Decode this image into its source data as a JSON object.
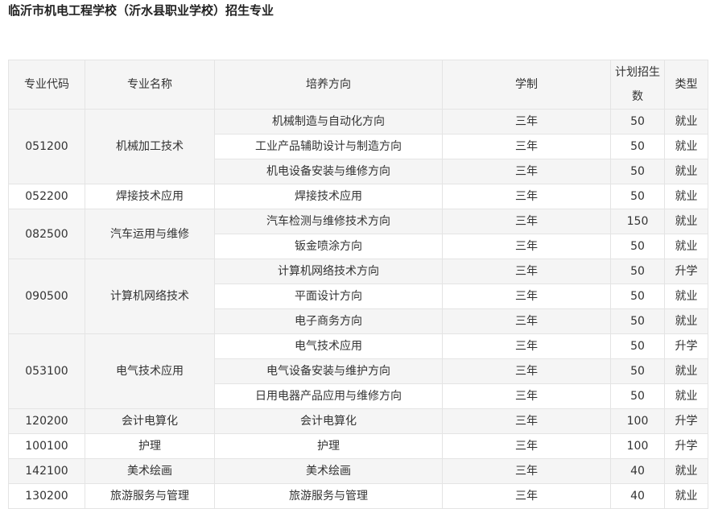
{
  "title": "临沂市机电工程学校（沂水县职业学校）招生专业",
  "headers": {
    "code": "专业代码",
    "name": "专业名称",
    "direction": "培养方向",
    "duration": "学制",
    "plan": "计划招生数",
    "type": "类型"
  },
  "groups": [
    {
      "code": "051200",
      "name": "机械加工技术",
      "rows": [
        {
          "direction": "机械制造与自动化方向",
          "duration": "三年",
          "plan": "50",
          "type": "就业"
        },
        {
          "direction": "工业产品辅助设计与制造方向",
          "duration": "三年",
          "plan": "50",
          "type": "就业"
        },
        {
          "direction": "机电设备安装与维修方向",
          "duration": "三年",
          "plan": "50",
          "type": "就业"
        }
      ]
    },
    {
      "code": "052200",
      "name": "焊接技术应用",
      "rows": [
        {
          "direction": "焊接技术应用",
          "duration": "三年",
          "plan": "50",
          "type": "就业"
        }
      ]
    },
    {
      "code": "082500",
      "name": "汽车运用与维修",
      "rows": [
        {
          "direction": "汽车检测与维修技术方向",
          "duration": "三年",
          "plan": "150",
          "type": "就业"
        },
        {
          "direction": "钣金喷涂方向",
          "duration": "三年",
          "plan": "50",
          "type": "就业"
        }
      ]
    },
    {
      "code": "090500",
      "name": "计算机网络技术",
      "rows": [
        {
          "direction": "计算机网络技术方向",
          "duration": "三年",
          "plan": "50",
          "type": "升学"
        },
        {
          "direction": "平面设计方向",
          "duration": "三年",
          "plan": "50",
          "type": "就业"
        },
        {
          "direction": "电子商务方向",
          "duration": "三年",
          "plan": "50",
          "type": "就业"
        }
      ]
    },
    {
      "code": "053100",
      "name": "电气技术应用",
      "rows": [
        {
          "direction": "电气技术应用",
          "duration": "三年",
          "plan": "50",
          "type": "升学"
        },
        {
          "direction": "电气设备安装与维护方向",
          "duration": "三年",
          "plan": "50",
          "type": "就业"
        },
        {
          "direction": "日用电器产品应用与维修方向",
          "duration": "三年",
          "plan": "50",
          "type": "就业"
        }
      ]
    },
    {
      "code": "120200",
      "name": "会计电算化",
      "rows": [
        {
          "direction": "会计电算化",
          "duration": "三年",
          "plan": "100",
          "type": "升学"
        }
      ]
    },
    {
      "code": "100100",
      "name": "护理",
      "rows": [
        {
          "direction": "护理",
          "duration": "三年",
          "plan": "100",
          "type": "升学"
        }
      ]
    },
    {
      "code": "142100",
      "name": "美术绘画",
      "rows": [
        {
          "direction": "美术绘画",
          "duration": "三年",
          "plan": "40",
          "type": "就业"
        }
      ]
    },
    {
      "code": "130200",
      "name": "旅游服务与管理",
      "rows": [
        {
          "direction": "旅游服务与管理",
          "duration": "三年",
          "plan": "40",
          "type": "就业"
        }
      ]
    }
  ]
}
